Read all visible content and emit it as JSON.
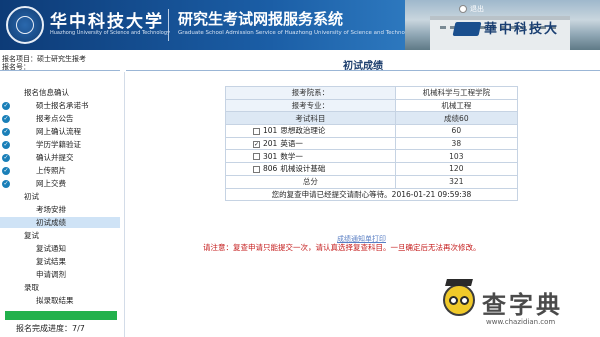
{
  "header": {
    "university_cn": "华中科技大学",
    "university_en": "Huazhong University of Science and Technology",
    "system_cn": "研究生考试网报服务系统",
    "system_en": "Graduate School Admission Service of Huazhong University of Science and Technology",
    "logout_label": "退出",
    "calligraphy": "華中科技大",
    "colors": {
      "primary": "#1b5ea6",
      "dark": "#0d3b77"
    }
  },
  "applicant": {
    "project_label": "报名项目：",
    "project_value": "硕士研究生报考",
    "regno_label": "报名号："
  },
  "page_title": "初试成绩",
  "sidebar": {
    "items": [
      {
        "label": "报名信息确认",
        "done": false,
        "indent": 0
      },
      {
        "label": "硕士报名承诺书",
        "done": true,
        "indent": 1
      },
      {
        "label": "报考点公告",
        "done": true,
        "indent": 1
      },
      {
        "label": "网上确认流程",
        "done": true,
        "indent": 1
      },
      {
        "label": "学历学籍验证",
        "done": true,
        "indent": 1
      },
      {
        "label": "确认并提交",
        "done": true,
        "indent": 1
      },
      {
        "label": "上传照片",
        "done": true,
        "indent": 1
      },
      {
        "label": "网上交费",
        "done": true,
        "indent": 1
      },
      {
        "label": "初试",
        "done": false,
        "indent": 0
      },
      {
        "label": "考场安排",
        "done": false,
        "indent": 1
      },
      {
        "label": "初试成绩",
        "done": false,
        "indent": 1,
        "active": true
      },
      {
        "label": "复试",
        "done": false,
        "indent": 0
      },
      {
        "label": "复试通知",
        "done": false,
        "indent": 1
      },
      {
        "label": "复试结果",
        "done": false,
        "indent": 1
      },
      {
        "label": "申请调剂",
        "done": false,
        "indent": 1
      },
      {
        "label": "录取",
        "done": false,
        "indent": 0
      },
      {
        "label": "拟录取结果",
        "done": false,
        "indent": 1
      }
    ],
    "progress_label": "报名完成进度：",
    "progress_value": "7/7",
    "progress_fraction": 1.0,
    "check_icon": "check-circle-icon"
  },
  "score_table": {
    "dept_label": "报考院系：",
    "dept_value": "机械科学与工程学院",
    "major_label": "报考专业：",
    "major_value": "机械工程",
    "subject_header": "考试科目",
    "score_header": "成绩60",
    "subjects": [
      {
        "code": "101",
        "name": "思想政治理论",
        "score": "60",
        "checked": false
      },
      {
        "code": "201",
        "name": "英语一",
        "score": "38",
        "checked": true
      },
      {
        "code": "301",
        "name": "数学一",
        "score": "103",
        "checked": false
      },
      {
        "code": "806",
        "name": "机械设计基础",
        "score": "120",
        "checked": false
      }
    ],
    "total_label": "总分",
    "total_value": "321",
    "status_message": "您的复查申请已经提交请耐心等待。2016-01-21 09:59:38"
  },
  "print_link": "成绩通知单打印",
  "notice": "请注意：复查申请只能提交一次，请认真选择复查科目。一旦确定后无法再次修改。",
  "watermark": {
    "text": "查字典",
    "url": "www.chazidian.com"
  }
}
